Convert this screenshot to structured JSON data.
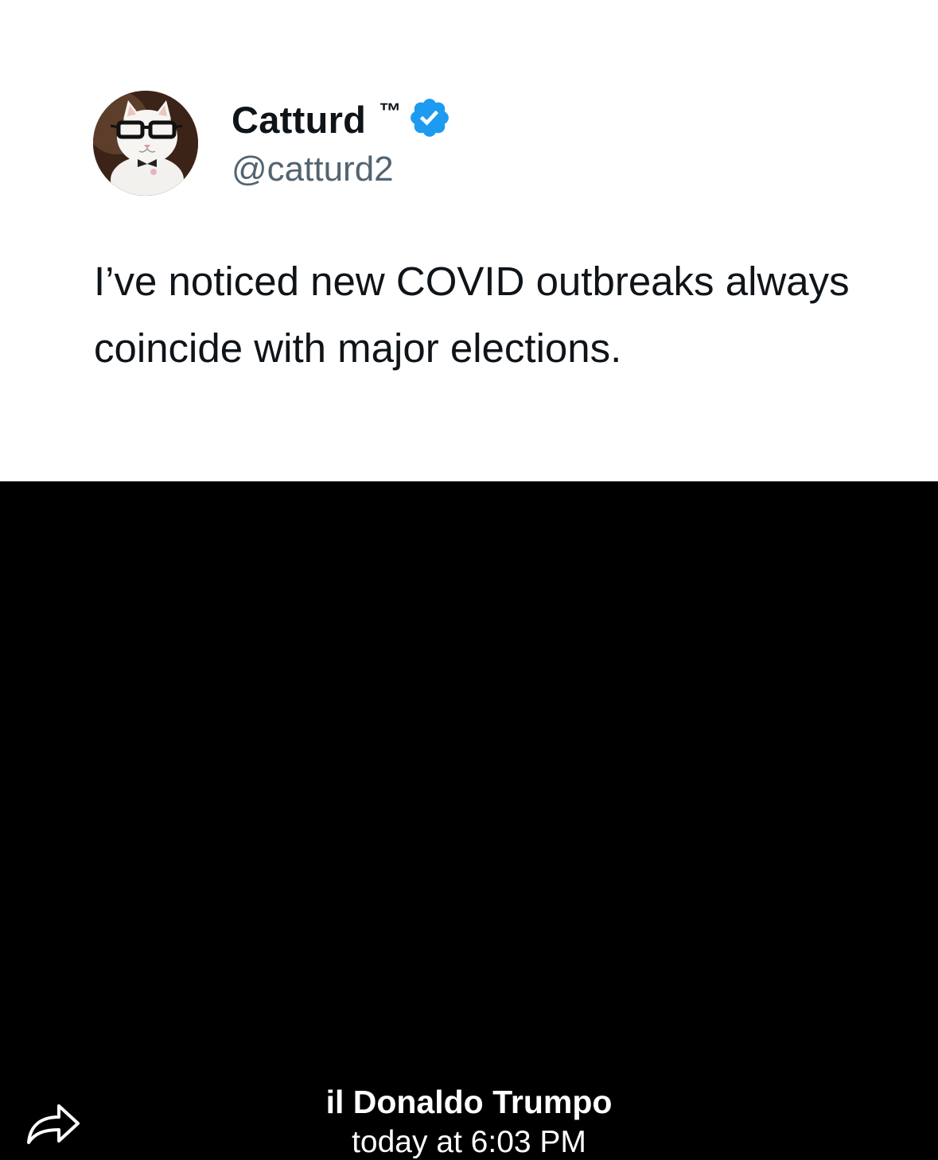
{
  "tweet": {
    "display_name": "Catturd",
    "trademark": "™",
    "handle": "@catturd2",
    "text": "I’ve noticed new COVID outbreaks always coincide with major elections.",
    "avatar_icon": "cat-with-glasses-avatar",
    "verified_icon": "verified-badge-icon",
    "verified_color": "#1d9bf0"
  },
  "message": {
    "sender": "il Donaldo Trumpo",
    "timestamp": "today at 6:03 PM",
    "share_icon": "share-arrow-icon"
  }
}
